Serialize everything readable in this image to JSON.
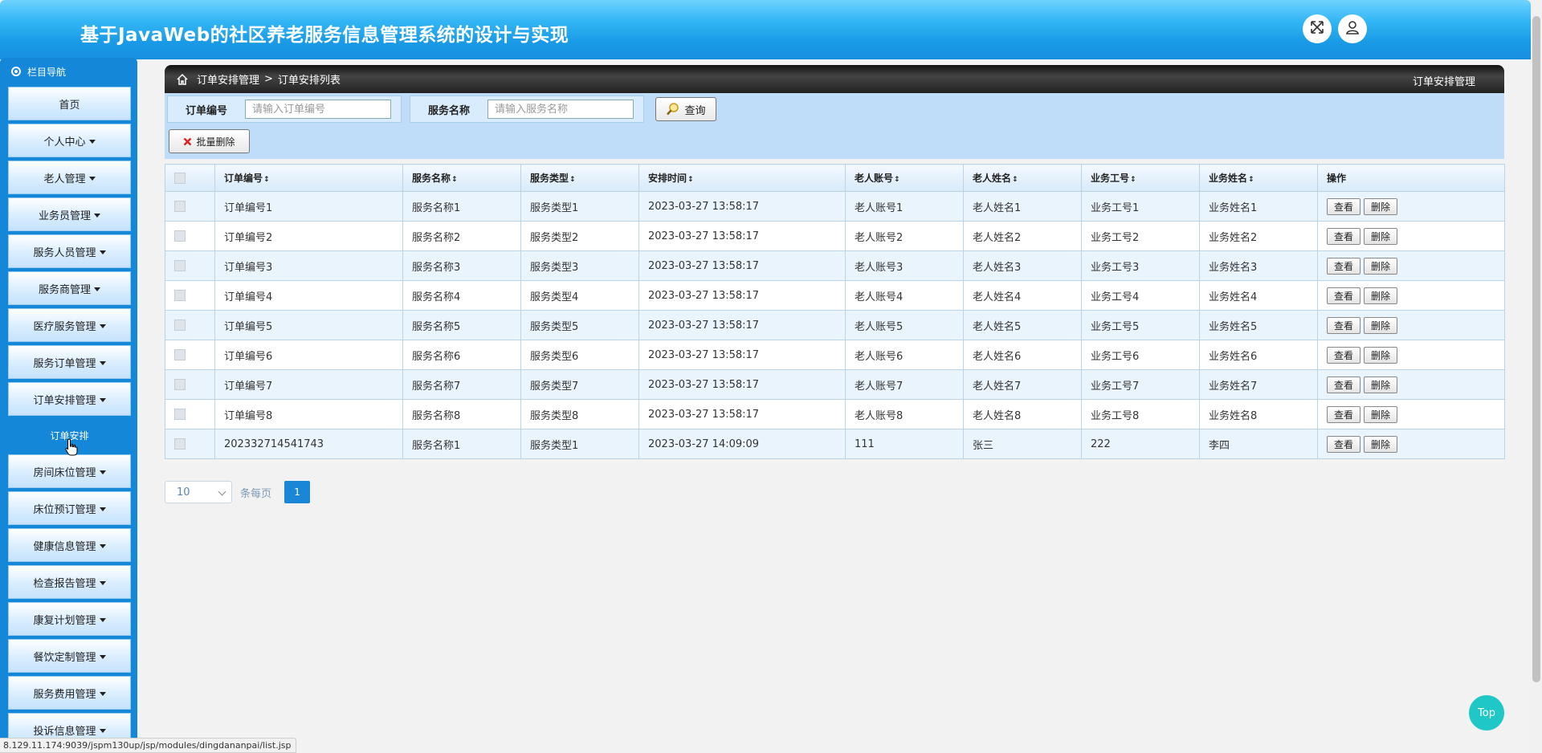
{
  "header": {
    "title": "基于JavaWeb的社区养老服务信息管理系统的设计与实现",
    "fullscreen_icon": "expand-arrows-icon",
    "user_icon": "user-icon"
  },
  "sidebar": {
    "title": "栏目导航",
    "items": [
      {
        "label": "首页",
        "caret": false
      },
      {
        "label": "个人中心",
        "caret": true
      },
      {
        "label": "老人管理",
        "caret": true
      },
      {
        "label": "业务员管理",
        "caret": true
      },
      {
        "label": "服务人员管理",
        "caret": true
      },
      {
        "label": "服务商管理",
        "caret": true
      },
      {
        "label": "医疗服务管理",
        "caret": true
      },
      {
        "label": "服务订单管理",
        "caret": true
      },
      {
        "label": "订单安排管理",
        "caret": true
      },
      {
        "label": "房间床位管理",
        "caret": true
      },
      {
        "label": "床位预订管理",
        "caret": true
      },
      {
        "label": "健康信息管理",
        "caret": true
      },
      {
        "label": "检查报告管理",
        "caret": true
      },
      {
        "label": "康复计划管理",
        "caret": true
      },
      {
        "label": "餐饮定制管理",
        "caret": true
      },
      {
        "label": "服务费用管理",
        "caret": true
      },
      {
        "label": "投诉信息管理",
        "caret": true
      }
    ],
    "submenu_label": "订单安排"
  },
  "breadcrumb": {
    "section": "订单安排管理",
    "separator": ">",
    "page": "订单安排列表",
    "right_title": "订单安排管理"
  },
  "search": {
    "order_no_label": "订单编号",
    "order_no_placeholder": "请输入订单编号",
    "service_name_label": "服务名称",
    "service_name_placeholder": "请输入服务名称",
    "query_button": "查询",
    "batch_delete_button": "批量删除"
  },
  "table": {
    "columns": [
      "订单编号",
      "服务名称",
      "服务类型",
      "安排时间",
      "老人账号",
      "老人姓名",
      "业务工号",
      "业务姓名",
      "操作"
    ],
    "view_label": "查看",
    "delete_label": "删除",
    "rows": [
      [
        "订单编号1",
        "服务名称1",
        "服务类型1",
        "2023-03-27 13:58:17",
        "老人账号1",
        "老人姓名1",
        "业务工号1",
        "业务姓名1"
      ],
      [
        "订单编号2",
        "服务名称2",
        "服务类型2",
        "2023-03-27 13:58:17",
        "老人账号2",
        "老人姓名2",
        "业务工号2",
        "业务姓名2"
      ],
      [
        "订单编号3",
        "服务名称3",
        "服务类型3",
        "2023-03-27 13:58:17",
        "老人账号3",
        "老人姓名3",
        "业务工号3",
        "业务姓名3"
      ],
      [
        "订单编号4",
        "服务名称4",
        "服务类型4",
        "2023-03-27 13:58:17",
        "老人账号4",
        "老人姓名4",
        "业务工号4",
        "业务姓名4"
      ],
      [
        "订单编号5",
        "服务名称5",
        "服务类型5",
        "2023-03-27 13:58:17",
        "老人账号5",
        "老人姓名5",
        "业务工号5",
        "业务姓名5"
      ],
      [
        "订单编号6",
        "服务名称6",
        "服务类型6",
        "2023-03-27 13:58:17",
        "老人账号6",
        "老人姓名6",
        "业务工号6",
        "业务姓名6"
      ],
      [
        "订单编号7",
        "服务名称7",
        "服务类型7",
        "2023-03-27 13:58:17",
        "老人账号7",
        "老人姓名7",
        "业务工号7",
        "业务姓名7"
      ],
      [
        "订单编号8",
        "服务名称8",
        "服务类型8",
        "2023-03-27 13:58:17",
        "老人账号8",
        "老人姓名8",
        "业务工号8",
        "业务姓名8"
      ],
      [
        "202332714541743",
        "服务名称1",
        "服务类型1",
        "2023-03-27 14:09:09",
        "111",
        "张三",
        "222",
        "李四"
      ]
    ]
  },
  "pager": {
    "page_size": "10",
    "per_page_label": "条每页",
    "current_page": "1"
  },
  "status_bar": "8.129.11.174:9039/jspm130up/jsp/modules/dingdananpai/list.jsp",
  "back_to_top": "Top",
  "colors": {
    "header_blue": "#1a9be6",
    "sidebar_blue": "#1587d8",
    "search_bg": "#bfdcf8",
    "top_button": "#1fc7c7",
    "page_active": "#1a86d6"
  }
}
